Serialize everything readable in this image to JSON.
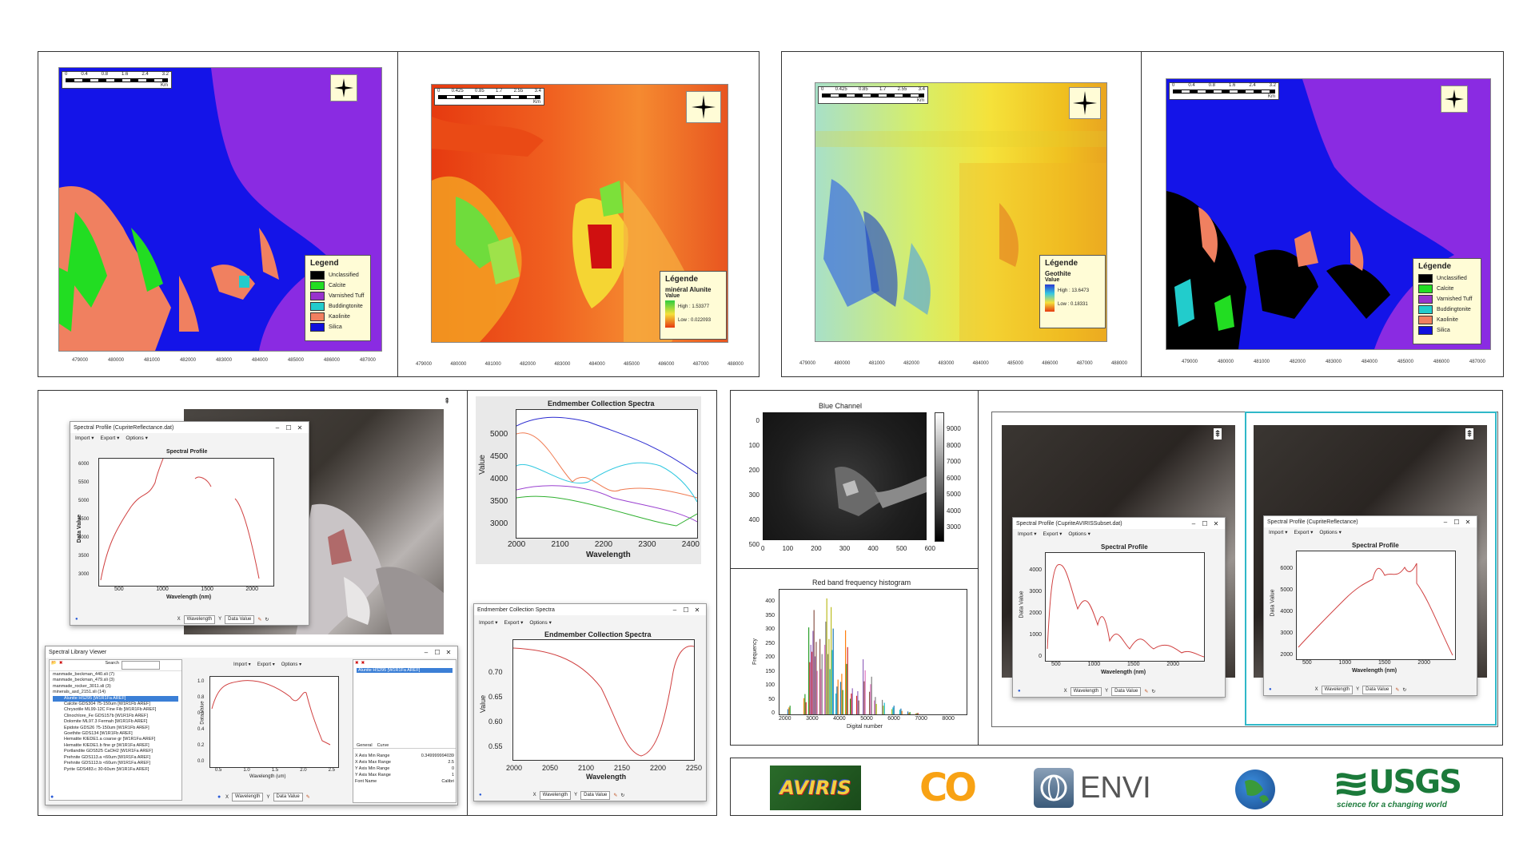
{
  "top_maps": {
    "x_ticks": [
      "479000",
      "480000",
      "481000",
      "482000",
      "483000",
      "484000",
      "485000",
      "486000",
      "487000"
    ],
    "x_ticks_b": [
      "479000",
      "480000",
      "481000",
      "482000",
      "483000",
      "484000",
      "485000",
      "486000",
      "487000",
      "488000"
    ],
    "scale_a": {
      "labels": [
        "0",
        "0.4",
        "0.8",
        "1.6",
        "2.4",
        "3.2"
      ],
      "unit": "Km"
    },
    "scale_b": {
      "labels": [
        "0",
        "0.425",
        "0.85",
        "1.7",
        "2.55",
        "3.4"
      ],
      "unit": "Km"
    },
    "north_label": "N",
    "map1_legend": {
      "title": "Legend",
      "items": [
        {
          "label": "Unclassified",
          "color": "#000000"
        },
        {
          "label": "Calcite",
          "color": "#22dd22"
        },
        {
          "label": "Varnished Tuff",
          "color": "#9933cc"
        },
        {
          "label": "Buddingtonite",
          "color": "#22cccc"
        },
        {
          "label": "Kaolinite",
          "color": "#f08060"
        },
        {
          "label": "Silica",
          "color": "#1010dd"
        }
      ]
    },
    "map2_legend": {
      "title": "Légende",
      "subtitle": "minéral Alunite",
      "value_label": "Value",
      "high": "High : 1.53377",
      "low": "Low : 0.022093"
    },
    "map3_legend": {
      "title": "Légende",
      "subtitle": "Geothite",
      "value_label": "Value",
      "high": "High : 13.6473",
      "low": "Low : 0.18331"
    },
    "map4_legend": {
      "title": "Légende",
      "items": [
        {
          "label": "Unclassified",
          "color": "#000000"
        },
        {
          "label": "Calcite",
          "color": "#22dd22"
        },
        {
          "label": "Varnished Tuff",
          "color": "#9933cc"
        },
        {
          "label": "Buddingtonite",
          "color": "#22cccc"
        },
        {
          "label": "Kaolinite",
          "color": "#f08060"
        },
        {
          "label": "Silica",
          "color": "#1010dd"
        }
      ]
    }
  },
  "spectral_profile_window": {
    "title": "Spectral Profile (CupriteReflectance.dat)",
    "menu": [
      "Import ▾",
      "Export ▾",
      "Options ▾"
    ],
    "plot_title": "Spectral Profile",
    "ylabel": "Data Value",
    "xlabel": "Wavelength (nm)",
    "x_ticks": [
      "500",
      "1000",
      "1500",
      "2000"
    ],
    "y_ticks": [
      "6000",
      "5500",
      "5000",
      "4500",
      "4000",
      "3500",
      "3000"
    ],
    "x_select": "Wavelength",
    "y_select": "Data Value",
    "x_axis_letter": "X",
    "y_axis_letter": "Y"
  },
  "spectral_library_viewer": {
    "title": "Spectral Library Viewer",
    "search_label": "Search",
    "menu": [
      "Import ▾",
      "Export ▾",
      "Options ▾"
    ],
    "tree": [
      "manmade_beckman_440.sli (7)",
      "manmade_beckman_479.sli (3)",
      "manmade_rocker_3011.sli (3)",
      "minerals_asd_2151.sli (14)",
      "Alunite HS295 [W1R1Fa AREF]",
      "Calcite GDS304 75-150um [W1R1Fb AREF]",
      "Chrysotile ML99-12C Fine Fib [W1R1Fb AREF]",
      "Clinochlore_Fe GDS157b [W1R1Fb AREF]",
      "Dolomite ML97.3 Fermah [W1R1Fb AREF]",
      "Epidote GDS26 75-150um [W1R1Fb AREF]",
      "Goethite GDS134 [W1R1Fb AREF]",
      "Hematite KIEDE1.a coarse gr [W1R1Fa AREF]",
      "Hematite KIEDE1.b fine gr [W1R1Fa AREF]",
      "Portlandite GDS525 CaOH2 [W1R1Fa AREF]",
      "Prehnite GDS113.a <60um [W1R1Fa AREF]",
      "Prehnite GDS113.b <60um [W1R1Fa AREF]",
      "Pyrite GDS483.c 30-60um [W1R1Fa AREF]"
    ],
    "plot_ylabel": "Data Value",
    "plot_xlabel": "Wavelength (um)",
    "x_ticks": [
      "0.5",
      "1.0",
      "1.5",
      "2.0",
      "2.5"
    ],
    "y_ticks": [
      "1.0",
      "0.8",
      "0.6",
      "0.4",
      "0.2",
      "0.0"
    ],
    "x_select": "Wavelength",
    "y_select": "Data Value",
    "x_axis_letter": "X",
    "y_axis_letter": "Y",
    "selected_item": "Alunite HS295 [W1R1Fa AREF]",
    "tabs": [
      "General",
      "Curve"
    ],
    "props": [
      {
        "k": "X Axis Min Range",
        "v": "0.349999994039"
      },
      {
        "k": "X Axis Max Range",
        "v": "2.5"
      },
      {
        "k": "Y Axis Min Range",
        "v": "0"
      },
      {
        "k": "Y Axis Max Range",
        "v": "1"
      },
      {
        "k": "Font Name",
        "v": "Calibri"
      }
    ]
  },
  "endmember_chart_top": {
    "title": "Endmember Collection Spectra",
    "xlabel": "Wavelength",
    "ylabel": "Value",
    "x_ticks": [
      "2000",
      "2100",
      "2200",
      "2300",
      "2400"
    ],
    "y_ticks": [
      "5000",
      "4500",
      "4000",
      "3500",
      "3000"
    ]
  },
  "endmember_window": {
    "title": "Endmember Collection Spectra",
    "menu": [
      "Import ▾",
      "Export ▾",
      "Options ▾"
    ],
    "plot_title": "Endmember Collection Spectra",
    "xlabel": "Wavelength",
    "ylabel": "Value",
    "x_ticks": [
      "2000",
      "2050",
      "2100",
      "2150",
      "2200",
      "2250"
    ],
    "y_ticks": [
      "0.70",
      "0.65",
      "0.60",
      "0.55"
    ],
    "x_select": "Wavelength",
    "y_select": "Data Value",
    "x_axis_letter": "X",
    "y_axis_letter": "Y"
  },
  "blue_channel": {
    "title": "Blue Channel",
    "x_ticks": [
      "0",
      "100",
      "200",
      "300",
      "400",
      "500",
      "600"
    ],
    "y_ticks": [
      "0",
      "100",
      "200",
      "300",
      "400",
      "500"
    ],
    "cbar_ticks": [
      "9000",
      "8000",
      "7000",
      "6000",
      "5000",
      "4000",
      "3000"
    ]
  },
  "histogram": {
    "title": "Red band frequency histogram",
    "xlabel": "Digital number",
    "ylabel": "Frequency",
    "x_ticks": [
      "2000",
      "3000",
      "4000",
      "5000",
      "6000",
      "7000",
      "8000"
    ],
    "y_ticks": [
      "400",
      "350",
      "300",
      "250",
      "200",
      "150",
      "100",
      "50",
      "0"
    ]
  },
  "right_profile_a": {
    "title": "Spectral Profile (CupriteAVIRISSubset.dat)",
    "menu": [
      "Import ▾",
      "Export ▾",
      "Options ▾"
    ],
    "plot_title": "Spectral Profile",
    "ylabel": "Data Value",
    "xlabel": "Wavelength (nm)",
    "x_ticks": [
      "500",
      "1000",
      "1500",
      "2000"
    ],
    "y_ticks": [
      "4000",
      "3000",
      "2000",
      "1000",
      "0"
    ],
    "x_select": "Wavelength",
    "y_select": "Data Value",
    "x_axis_letter": "X",
    "y_axis_letter": "Y"
  },
  "right_profile_b": {
    "title": "Spectral Profile (CupriteReflectance)",
    "menu": [
      "Import ▾",
      "Export ▾",
      "Options ▾"
    ],
    "plot_title": "Spectral Profile",
    "ylabel": "Data Value",
    "xlabel": "Wavelength (nm)",
    "x_ticks": [
      "500",
      "1000",
      "1500",
      "2000"
    ],
    "y_ticks": [
      "6000",
      "5000",
      "4000",
      "3000",
      "2000"
    ],
    "x_select": "Wavelength",
    "y_select": "Data Value",
    "x_axis_letter": "X",
    "y_axis_letter": "Y"
  },
  "logos": {
    "aviris": "AVIRIS",
    "co": "CO",
    "envi": "ENVI",
    "usgs": "USGS",
    "usgs_tagline": "science for a changing world"
  }
}
